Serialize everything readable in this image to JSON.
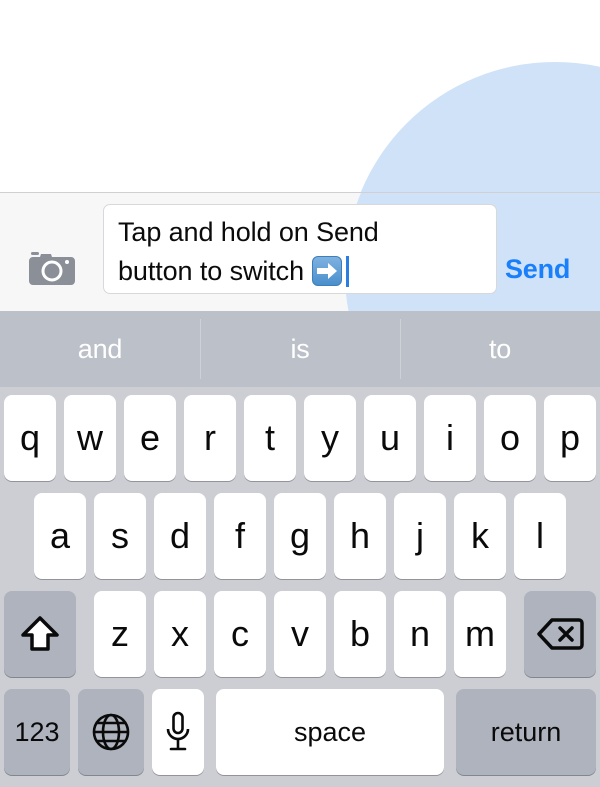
{
  "conversation": {
    "bubble_color": "#cfe2f8"
  },
  "toolbar": {
    "camera_icon": "camera-icon",
    "text_value_line1": "Tap and hold on Send",
    "text_value_line2": "button to switch ",
    "emoji": "right-arrow-emoji",
    "send_label": "Send",
    "send_color": "#1a7ffb"
  },
  "suggestions": {
    "items": [
      {
        "label": "and"
      },
      {
        "label": "is"
      },
      {
        "label": "to"
      }
    ]
  },
  "keyboard": {
    "row1": [
      {
        "label": "q"
      },
      {
        "label": "w"
      },
      {
        "label": "e"
      },
      {
        "label": "r"
      },
      {
        "label": "t"
      },
      {
        "label": "y"
      },
      {
        "label": "u"
      },
      {
        "label": "i"
      },
      {
        "label": "o"
      },
      {
        "label": "p"
      }
    ],
    "row2": [
      {
        "label": "a"
      },
      {
        "label": "s"
      },
      {
        "label": "d"
      },
      {
        "label": "f"
      },
      {
        "label": "g"
      },
      {
        "label": "h"
      },
      {
        "label": "j"
      },
      {
        "label": "k"
      },
      {
        "label": "l"
      }
    ],
    "row3": [
      {
        "label": "z"
      },
      {
        "label": "x"
      },
      {
        "label": "c"
      },
      {
        "label": "v"
      },
      {
        "label": "b"
      },
      {
        "label": "n"
      },
      {
        "label": "m"
      }
    ],
    "shift_icon": "shift-arrow-icon",
    "backspace_icon": "backspace-icon",
    "numeric_label": "123",
    "globe_icon": "globe-icon",
    "mic_icon": "microphone-icon",
    "space_label": "space",
    "return_label": "return"
  }
}
